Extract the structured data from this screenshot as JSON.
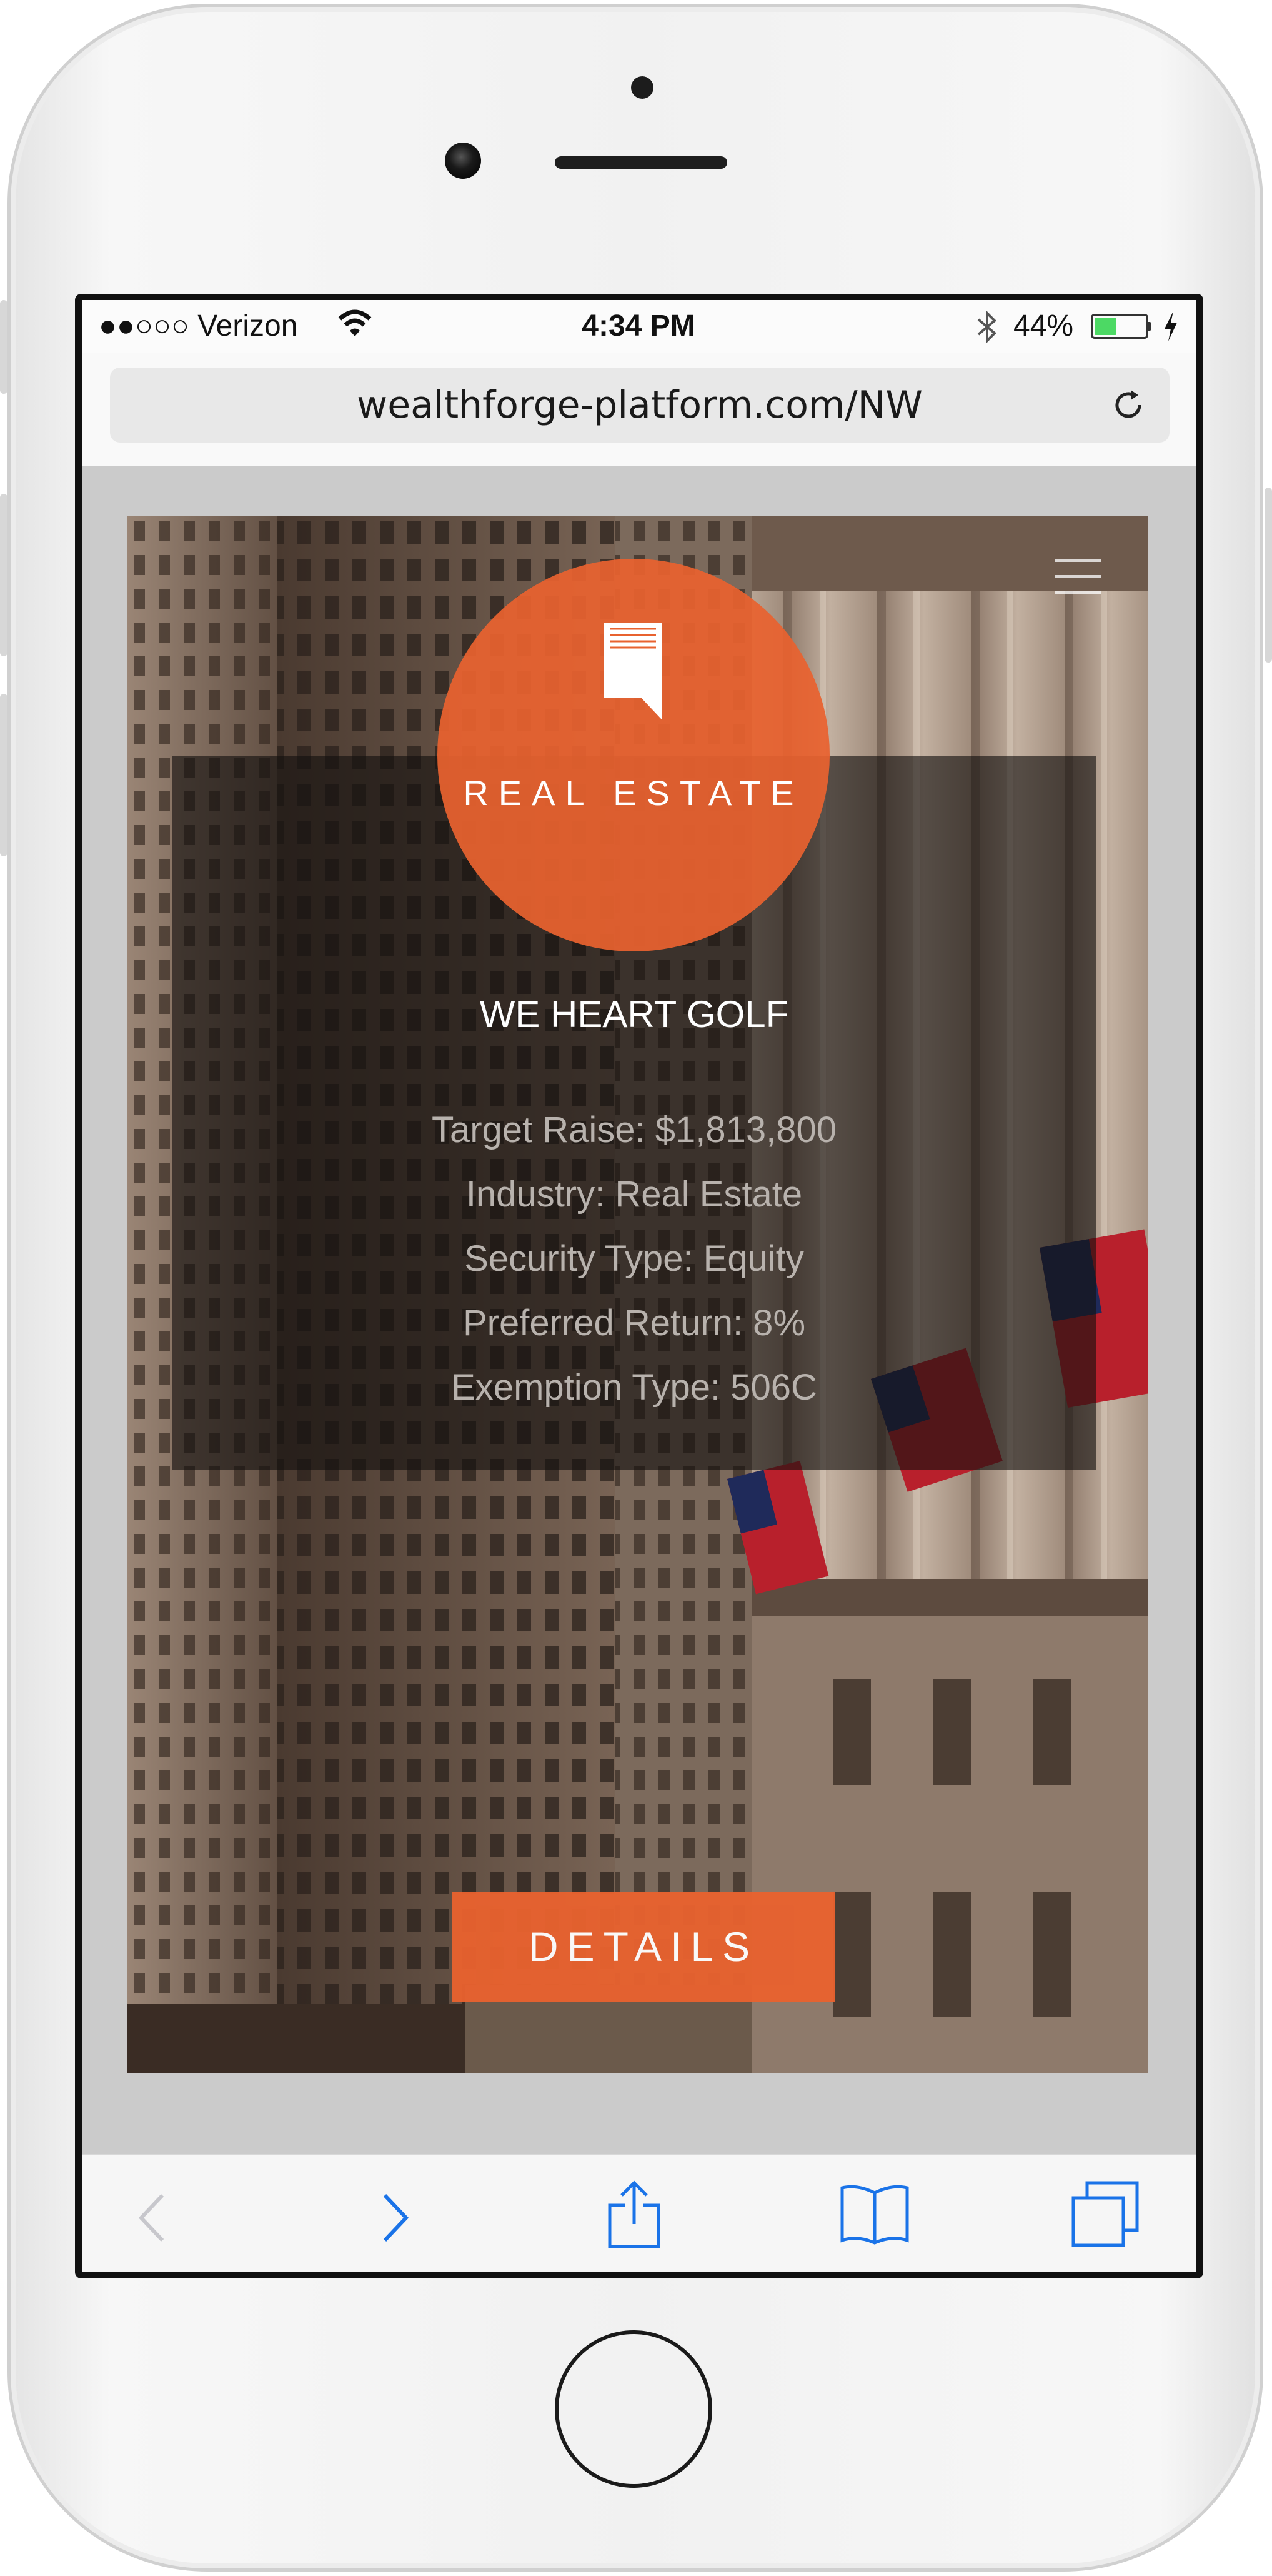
{
  "status_bar": {
    "carrier": "●●○○○ Verizon",
    "time": "4:34 PM",
    "battery_percent": "44%",
    "battery_level": 0.44,
    "icons": [
      "wifi-icon",
      "bluetooth-icon",
      "battery-icon",
      "charging-bolt-icon"
    ]
  },
  "browser": {
    "url": "wealthforge-platform.com/NW",
    "reload_icon": "reload-icon"
  },
  "listing": {
    "category": "REAL ESTATE",
    "category_icon": "document-bookmark-icon",
    "menu_icon": "hamburger-menu-icon",
    "title": "WE HEART GOLF",
    "details": [
      "Target Raise: $1,813,800",
      "Industry: Real Estate",
      "Security Type: Equity",
      "Preferred Return: 8%",
      "Exemption Type: 506C"
    ],
    "button_label": "DETAILS",
    "accent_color": "#e8622f"
  },
  "toolbar": {
    "icons": [
      "back-icon",
      "forward-icon",
      "share-icon",
      "bookmarks-icon",
      "tabs-icon"
    ],
    "back_enabled": false,
    "accent_color": "#1a73e8"
  }
}
